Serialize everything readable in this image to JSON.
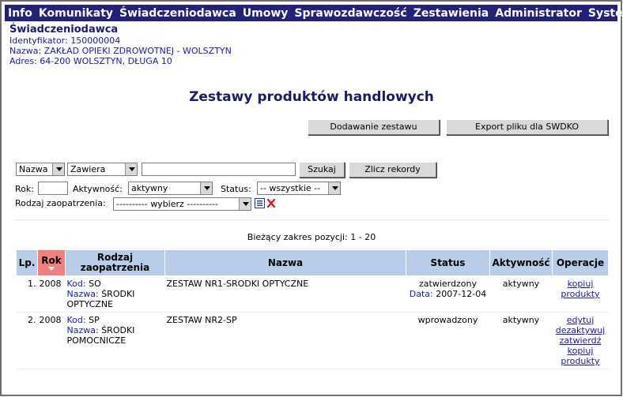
{
  "menu": [
    "Info",
    "Komunikaty",
    "Świadczeniodawca",
    "Umowy",
    "Sprawozdawczość",
    "Zestawienia",
    "Administrator",
    "System"
  ],
  "provider": {
    "title": "Świadczeniodawca",
    "id_line": "Identyfikator: 150000004",
    "name_line": "Nazwa: ZAKŁAD OPIEKI ZDROWOTNEJ - WOLSZTYN",
    "address_line": "Adres: 64-200 WOLSZTYN, DŁUGA 10"
  },
  "page_title": "Zestawy produktów handlowych",
  "buttons": {
    "add_set": "Dodawanie zestawu",
    "export": "Export pliku dla SWDKO",
    "search": "Szukaj",
    "count": "Zlicz rekordy"
  },
  "filters": {
    "field": "Nazwa",
    "operator": "Zawiera",
    "search_value": "",
    "year_label": "Rok:",
    "year_value": "",
    "activity_label": "Aktywność:",
    "activity_value": "aktywny",
    "status_label": "Status:",
    "status_value": "-- wszystkie --",
    "supply_label": "Rodzaj zaopatrzenia:",
    "supply_value": "---------- wybierz ----------",
    "list_icon": "list-icon",
    "clear_icon": "clear-x-icon"
  },
  "range_text": "Bieżący zakres pozycji: 1 - 20",
  "table": {
    "headers": {
      "lp": "Lp.",
      "rok": "Rok",
      "rodzaj": "Rodzaj zaopatrzenia",
      "nazwa": "Nazwa",
      "status": "Status",
      "aktywnosc": "Aktywność",
      "operacje": "Operacje"
    },
    "rows": [
      {
        "lp": "1.",
        "rok": "2008",
        "kod_label": "Kod:",
        "kod": "SO",
        "nazwa_label": "Nazwa:",
        "nazwa_rodzaj": "ŚRODKI OPTYCZNE",
        "nazwa": "ZESTAW NR1-SRODKI OPTYCZNE",
        "status": "zatwierdzony",
        "data_label": "Data:",
        "data": "2007-12-04",
        "aktywnosc": "aktywny",
        "ops": [
          "kopiuj",
          "produkty"
        ]
      },
      {
        "lp": "2.",
        "rok": "2008",
        "kod_label": "Kod:",
        "kod": "SP",
        "nazwa_label": "Nazwa:",
        "nazwa_rodzaj": "ŚRODKI POMOCNICZE",
        "nazwa": "ZESTAW NR2-SP",
        "status": "wprowadzony",
        "aktywnosc": "aktywny",
        "ops": [
          "edytuj",
          "dezaktywuj",
          "zatwierdź",
          "kopiuj",
          "produkty"
        ]
      }
    ]
  }
}
